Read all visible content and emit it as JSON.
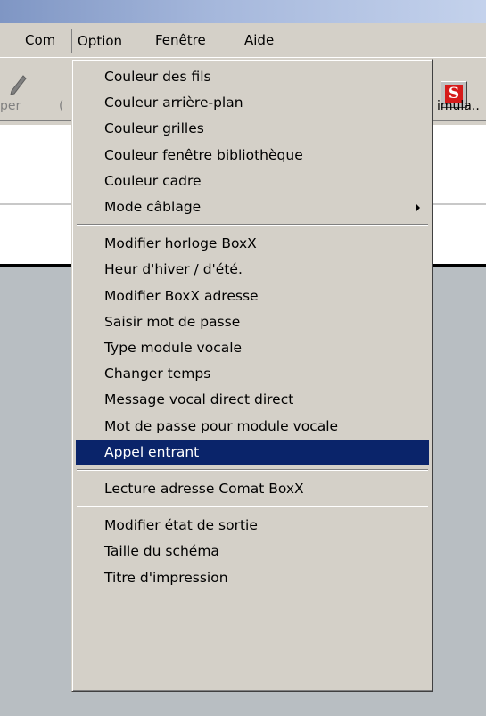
{
  "menubar": {
    "items": [
      {
        "label": "Com",
        "open": false
      },
      {
        "label": "Option",
        "open": true
      },
      {
        "label": "Fenêtre",
        "open": false
      },
      {
        "label": "Aide",
        "open": false
      }
    ]
  },
  "toolbar": {
    "left_label": "per",
    "left_label2": "(",
    "sim_icon_letter": "S",
    "sim_label": "imula..",
    "colors": {
      "sim_icon": "#d61a1a"
    }
  },
  "dropdown": {
    "groups": [
      {
        "items": [
          {
            "label": "Couleur des fils"
          },
          {
            "label": "Couleur arrière-plan"
          },
          {
            "label": "Couleur grilles"
          },
          {
            "label": "Couleur fenêtre bibliothèque"
          },
          {
            "label": "Couleur cadre"
          },
          {
            "label": "Mode câblage",
            "submenu": true
          }
        ]
      },
      {
        "items": [
          {
            "label": "Modifier horloge BoxX"
          },
          {
            "label": "Heur d'hiver / d'été."
          },
          {
            "label": "Modifier BoxX adresse"
          },
          {
            "label": "Saisir mot de passe"
          },
          {
            "label": "Type module vocale"
          },
          {
            "label": "Changer temps"
          },
          {
            "label": "Message vocal direct direct"
          },
          {
            "label": "Mot de passe pour module vocale"
          },
          {
            "label": "Appel entrant",
            "highlighted": true
          }
        ]
      },
      {
        "items": [
          {
            "label": "Lecture adresse Comat BoxX"
          }
        ]
      },
      {
        "items": [
          {
            "label": "Modifier état de sortie"
          },
          {
            "label": "Taille du schéma"
          },
          {
            "label": "Titre d'impression"
          }
        ]
      }
    ],
    "colors": {
      "highlight_bg": "#0a246a",
      "highlight_fg": "#ffffff"
    }
  }
}
